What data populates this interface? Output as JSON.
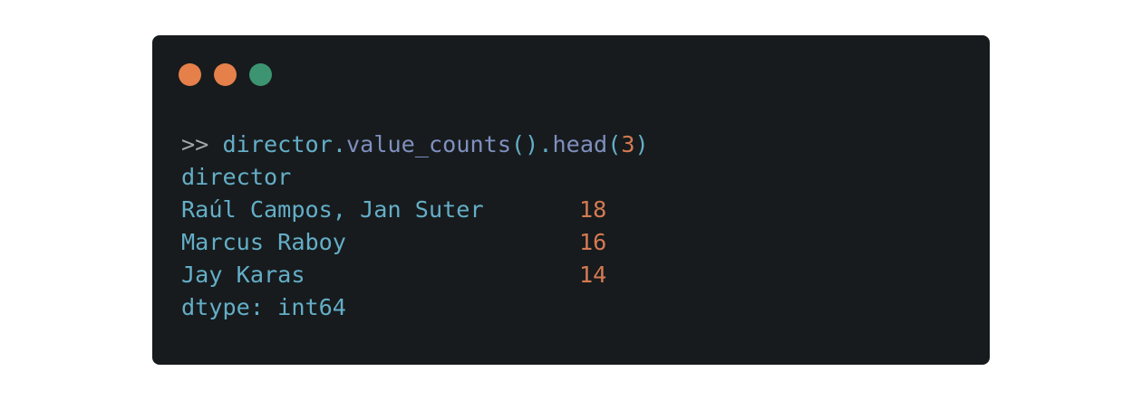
{
  "window": {
    "controls": [
      {
        "name": "close",
        "color": "#e5804a"
      },
      {
        "name": "minimize",
        "color": "#e5804a"
      },
      {
        "name": "maximize",
        "color": "#3c9471"
      }
    ]
  },
  "code": {
    "prompt": ">>",
    "command": {
      "object": "director",
      "dot1": ".",
      "method1": "value_counts",
      "paren1": "()",
      "dot2": ".",
      "method2": "head",
      "open": "(",
      "arg": "3",
      "close": ")"
    },
    "output": {
      "header": "director",
      "rows": [
        {
          "label": "Raúl Campos, Jan Suter",
          "value": "18"
        },
        {
          "label": "Marcus Raboy",
          "value": "16"
        },
        {
          "label": "Jay Karas",
          "value": "14"
        }
      ],
      "dtype": "dtype: int64"
    }
  },
  "colors": {
    "background": "#171b1d",
    "text": "#64aec7",
    "prompt": "#a3a7a9",
    "method": "#7f8fbf",
    "number": "#d47a52"
  }
}
